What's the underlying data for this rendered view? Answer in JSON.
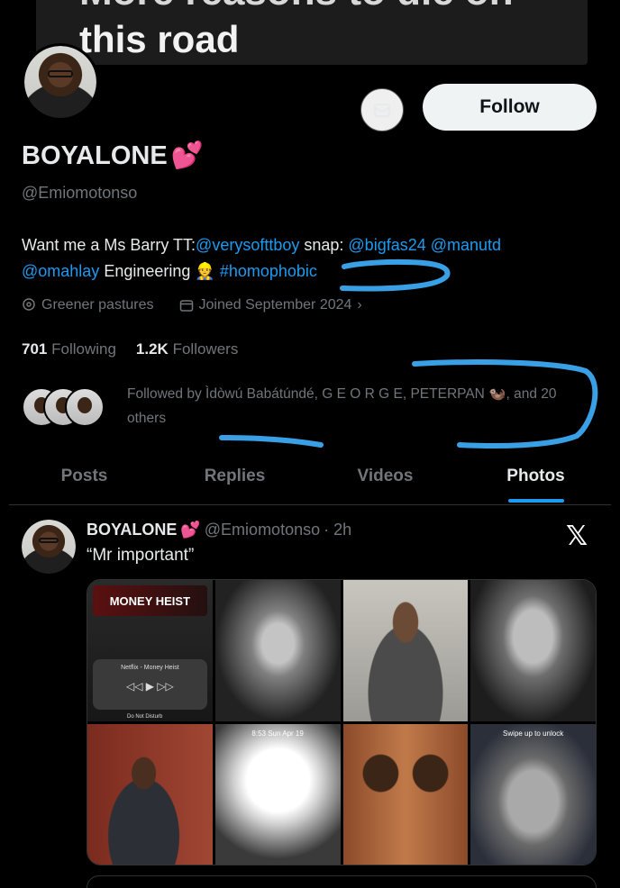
{
  "quoted_header": {
    "line1": "More reasons to die on",
    "line2": "this road"
  },
  "profile": {
    "name": "BOYALONE",
    "name_emoji": "💕",
    "handle": "@Emiomotonso",
    "follow_label": "Follow",
    "bio": {
      "t1": "Want me a Ms Barry TT:",
      "l1": "@verysofttboy",
      "t2": " snap: ",
      "l2": "@bigfas24",
      "t3": " ",
      "l3": "@manutd",
      "l4": "@omahlay",
      "t4": " Engineering 👷 ",
      "l5": "#homophobic"
    },
    "location": "Greener pastures",
    "joined": "Joined September 2024",
    "following_count": "701",
    "following_label": "Following",
    "followers_count": "1.2K",
    "followers_label": "Followers",
    "followed_by": "Followed by Ìdòwú Babátúndé, G E O R G E, PETERPAN 🦦, and 20 others"
  },
  "tabs": [
    {
      "label": "Posts"
    },
    {
      "label": "Replies"
    },
    {
      "label": "Videos"
    },
    {
      "label": "Photos"
    }
  ],
  "post": {
    "name": "BOYALONE",
    "name_emoji": "💕",
    "handle": "@Emiomotonso",
    "time": "· 2h",
    "text": "“Mr important”",
    "media": {
      "banner": "MONEY HEIST",
      "player_title": "Netflix - Money Heist",
      "dnd": "Do Not Disturb",
      "lockscreen_time": "8:53  Sun Apr 19",
      "lock_text": "Swipe up to unlock"
    }
  },
  "colors": {
    "accent": "#1d9bf0",
    "background": "#000000",
    "muted": "#71767b"
  }
}
